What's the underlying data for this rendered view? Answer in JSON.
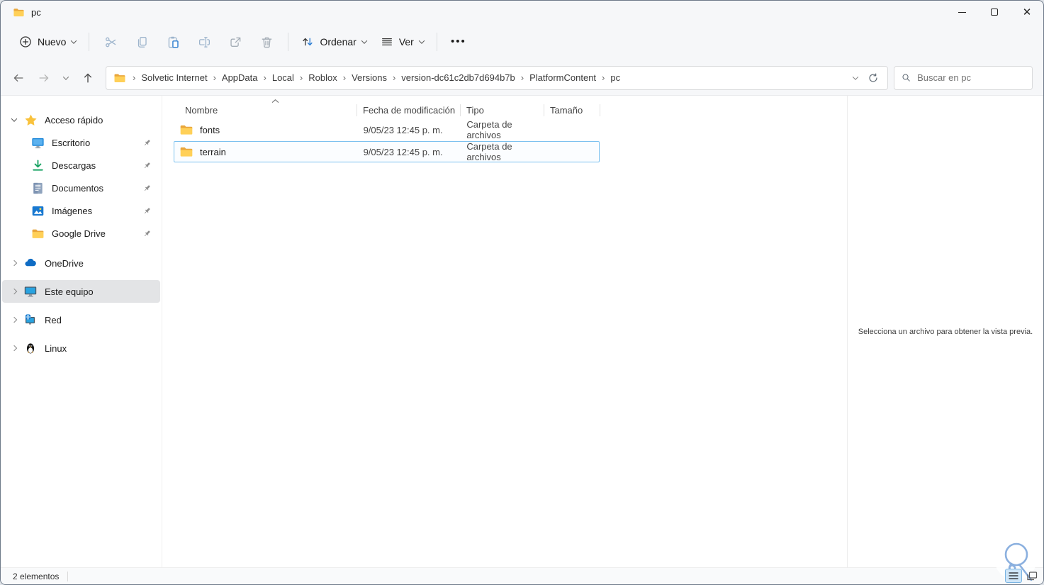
{
  "window": {
    "title": "pc"
  },
  "toolbar": {
    "new_label": "Nuevo",
    "sort_label": "Ordenar",
    "view_label": "Ver",
    "more_glyph": "•••"
  },
  "addressbar": {
    "separator": "›",
    "breadcrumbs": [
      "Solvetic Internet",
      "AppData",
      "Local",
      "Roblox",
      "Versions",
      "version-dc61c2db7d694b7b",
      "PlatformContent",
      "pc"
    ]
  },
  "search": {
    "placeholder": "Buscar en pc"
  },
  "sidebar": {
    "quick_access": {
      "label": "Acceso rápido",
      "items": [
        {
          "label": "Escritorio",
          "icon": "desktop-icon",
          "pinned": true
        },
        {
          "label": "Descargas",
          "icon": "downloads-icon",
          "pinned": true
        },
        {
          "label": "Documentos",
          "icon": "documents-icon",
          "pinned": true
        },
        {
          "label": "Imágenes",
          "icon": "pictures-icon",
          "pinned": true
        },
        {
          "label": "Google Drive",
          "icon": "folder-icon",
          "pinned": true
        }
      ]
    },
    "tree": [
      {
        "label": "OneDrive",
        "icon": "onedrive-cloud-icon",
        "selected": false
      },
      {
        "label": "Este equipo",
        "icon": "this-pc-icon",
        "selected": true
      },
      {
        "label": "Red",
        "icon": "network-icon",
        "selected": false
      },
      {
        "label": "Linux",
        "icon": "linux-penguin-icon",
        "selected": false
      }
    ]
  },
  "filelist": {
    "columns": [
      "Nombre",
      "Fecha de modificación",
      "Tipo",
      "Tamaño"
    ],
    "sort": {
      "column": "Nombre",
      "direction": "asc"
    },
    "rows": [
      {
        "name": "fonts",
        "modified": "9/05/23 12:45 p. m.",
        "type": "Carpeta de archivos",
        "size": "",
        "icon": "folder-icon",
        "selected": false
      },
      {
        "name": "terrain",
        "modified": "9/05/23 12:45 p. m.",
        "type": "Carpeta de archivos",
        "size": "",
        "icon": "folder-icon",
        "selected": true
      }
    ]
  },
  "preview": {
    "message": "Selecciona un archivo para obtener la vista previa."
  },
  "statusbar": {
    "items_count": "2 elementos"
  },
  "colors": {
    "accent": "#0b74d1",
    "folder_front": "#ffd058",
    "folder_back": "#e9a63c",
    "selection_border": "#7cc1ef",
    "chrome_bg": "#f6f7f9",
    "disabled_icon": "#9db4cc"
  }
}
